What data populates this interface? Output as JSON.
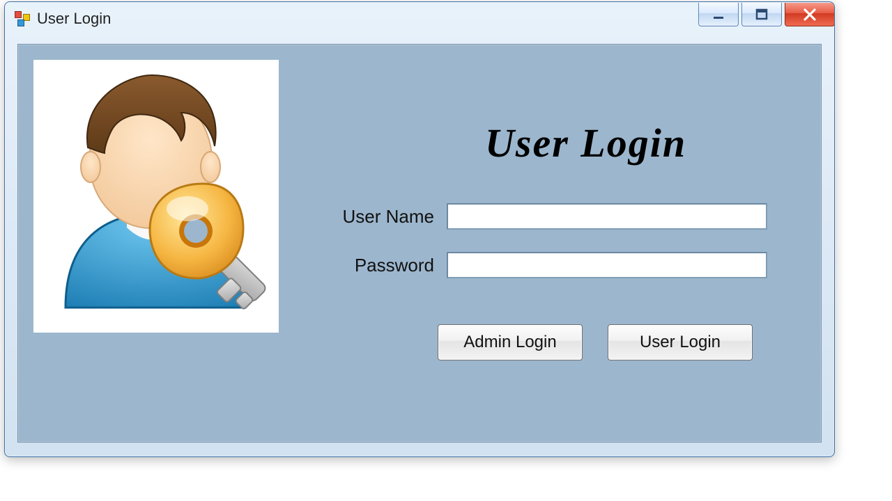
{
  "window": {
    "title": "User Login"
  },
  "heading": "User Login",
  "fields": {
    "username_label": "User Name",
    "username_value": "",
    "password_label": "Password",
    "password_value": ""
  },
  "buttons": {
    "admin_login": "Admin Login",
    "user_login": "User Login"
  },
  "icons": {
    "app": "winforms-app-icon",
    "picture": "user-with-key-icon",
    "minimize": "minimize-icon",
    "maximize": "maximize-icon",
    "close": "close-icon"
  }
}
